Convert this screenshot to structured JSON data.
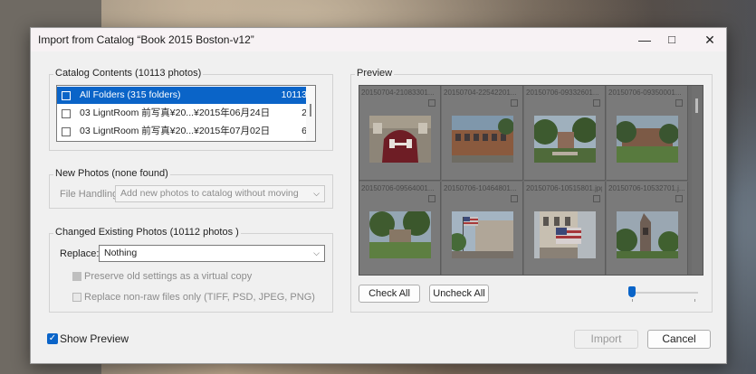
{
  "window": {
    "title": "Import from Catalog “Book 2015 Boston-v12”",
    "minimize": "—",
    "maximize": "□",
    "close": "✕"
  },
  "catalog_contents": {
    "label": "Catalog Contents (10113 photos)",
    "items": [
      {
        "name": "All Folders (315 folders)",
        "count": "10113",
        "selected": true
      },
      {
        "name": "03 LigntRoom 前写真¥20...¥2015年06月24日",
        "count": "2",
        "selected": false
      },
      {
        "name": "03 LigntRoom 前写真¥20...¥2015年07月02日",
        "count": "6",
        "selected": false
      }
    ]
  },
  "new_photos": {
    "label": "New Photos (none found)",
    "file_handling_label": "File Handling:",
    "file_handling_value": "Add new photos to catalog without moving"
  },
  "changed_photos": {
    "label": "Changed Existing Photos (10112 photos )",
    "replace_label": "Replace:",
    "replace_value": "Nothing",
    "preserve_label": "Preserve old settings as a virtual copy",
    "nonraw_label": "Replace non-raw files only (TIFF, PSD, JPEG, PNG)"
  },
  "preview": {
    "label": "Preview",
    "thumbnails": [
      {
        "name": "20150704-21083301...",
        "photo": "person-hoodie"
      },
      {
        "name": "20150704-22542201...",
        "photo": "building-brick"
      },
      {
        "name": "20150706-09332601...",
        "photo": "campus-trees"
      },
      {
        "name": "20150706-09350001...",
        "photo": "campus-lawn"
      },
      {
        "name": "20150706-09564001...",
        "photo": "campus-lawn"
      },
      {
        "name": "20150706-10464801...",
        "photo": "flag-building"
      },
      {
        "name": "20150706-10515801.jpg",
        "photo": "flag-building"
      },
      {
        "name": "20150706-10532701.j...",
        "photo": "church-tower"
      }
    ],
    "check_all": "Check All",
    "uncheck_all": "Uncheck All",
    "zoom": 0
  },
  "footer": {
    "show_preview_label": "Show Preview",
    "import_label": "Import",
    "cancel_label": "Cancel"
  },
  "colors": {
    "accent": "#0a64c8",
    "preview_bg": "#6c6c6c"
  }
}
